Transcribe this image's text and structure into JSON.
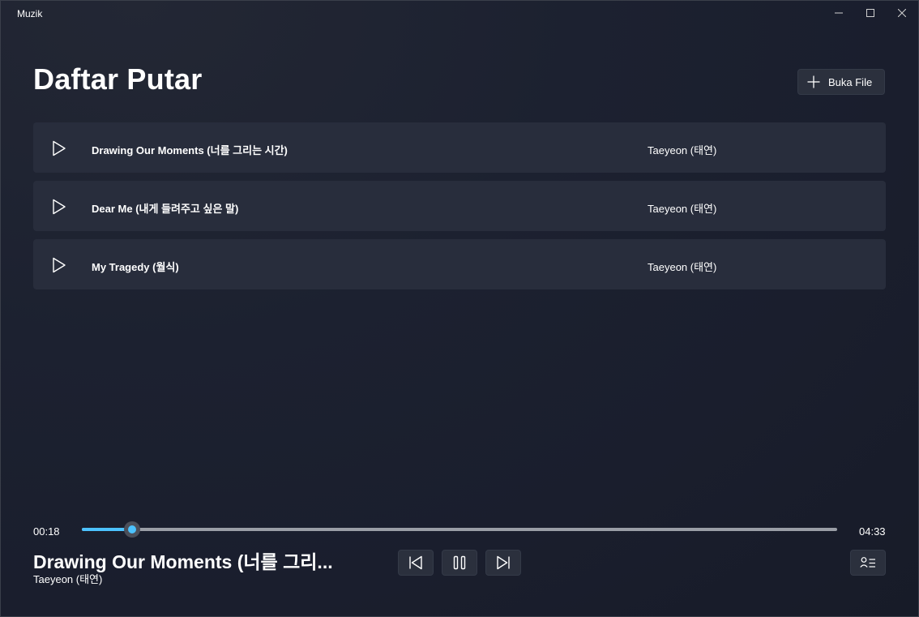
{
  "window": {
    "title": "Muzik",
    "controls": {
      "minimize_icon": "minimize-icon",
      "maximize_icon": "maximize-icon",
      "close_icon": "close-icon"
    }
  },
  "header": {
    "title": "Daftar Putar",
    "open_file_label": "Buka File",
    "open_file_icon": "plus-icon"
  },
  "playlist": [
    {
      "title": "Drawing Our Moments (너를 그리는 시간)",
      "artist": "Taeyeon (태연)"
    },
    {
      "title": "Dear Me (내게 들려주고 싶은 말)",
      "artist": "Taeyeon (태연)"
    },
    {
      "title": "My Tragedy (월식)",
      "artist": "Taeyeon (태연)"
    }
  ],
  "player": {
    "current_time": "00:18",
    "total_time": "04:33",
    "progress": 0.066,
    "now_playing_title": "Drawing Our Moments (너를 그리...",
    "now_playing_artist": "Taeyeon (태연)",
    "controls": [
      "previous-icon",
      "pause-icon",
      "next-icon",
      "queue-icon"
    ]
  },
  "colors": {
    "accent": "#4cc2ff",
    "background": "#1a1f2c",
    "row": "#282d3c"
  }
}
